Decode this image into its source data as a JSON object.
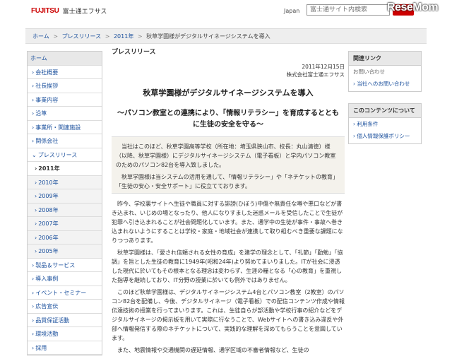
{
  "header": {
    "brand": "FUJITSU",
    "company": "富士通エフサス",
    "country": "Japan",
    "search_placeholder": "富士通サイト内検索",
    "watermark": "ReseMom"
  },
  "breadcrumb": {
    "items": [
      "ホーム",
      "プレスリリース",
      "2011年"
    ],
    "current": "秋草学園様がデジタルサイネージシステムを導入",
    "separator": ">"
  },
  "leftnav": {
    "items": [
      {
        "label": "ホーム"
      },
      {
        "label": "会社概要"
      },
      {
        "label": "社長挨拶"
      },
      {
        "label": "事業内容"
      },
      {
        "label": "沿革"
      },
      {
        "label": "事業所・関連施設"
      },
      {
        "label": "関係会社"
      },
      {
        "label": "プレスリリース"
      },
      {
        "label": "2011年"
      },
      {
        "label": "2010年"
      },
      {
        "label": "2009年"
      },
      {
        "label": "2008年"
      },
      {
        "label": "2007年"
      },
      {
        "label": "2006年"
      },
      {
        "label": "2005年"
      },
      {
        "label": "製品＆サービス"
      },
      {
        "label": "導入事例"
      },
      {
        "label": "イベント・セミナー"
      },
      {
        "label": "広告宣伝"
      },
      {
        "label": "品質保証活動"
      },
      {
        "label": "環境活動"
      },
      {
        "label": "採用"
      }
    ]
  },
  "main": {
    "section_label": "プレスリリース",
    "date": "2011年12月15日",
    "org": "株式会社富士通エフサス",
    "title": "秋草学園様がデジタルサイネージシステムを導入",
    "subtitle": "～パソコン教室との連携により、「情報リテラシー」を育成するとともに生徒の安全を守る～",
    "intro_1": "当社はこのほど、秋草学園高等学校（所在地：埼玉県狭山市、校長：丸山清徳）様（以降、秋草学園様）にデジタルサイネージシステム（電子看板）と学内パソコン教室のためのパソコン82台を導入致しました。",
    "intro_2": "秋草学園様は当システムの活用を通して、「情報リテラシー」や「ネチケットの教育」「生徒の安心・安全サポート」に役立てております。",
    "p1": "昨今、学校裏サイトへ生徒や職員に対する誹謗(ひぼう)中傷や無責任な噂や悪口などが書き込まれ、いじめの場となったり、他人になりすました迷惑メールを受信したことで生徒が犯罪へ引き込まれることが社会問題化しています。また、通学中の生徒が事件・事故へ巻き込まれないようにすることは学校・家庭・地域社会が連携して取り組むべき重要な課題になりつつあります。",
    "p2": "秋草学園様は、「愛され信頼される女性の育成」を建学の理念として、「礼節」「勤勉」「協調」を旨とした生徒の教育に1949年(昭和24年)より努めてまいりました。ITが社会に浸透した現代に於いてもその根本となる理念は変わらず、生涯の糧となる「心の教育」を重視した指導を継続しており、IT分野の授業に於いても例外ではありません。",
    "p3": "このほど秋草学園様は、デジタルサイネージシステム4台とパソコン教室（2教室）のパソコン82台を配備し、今後、デジタルサイネージ（電子看板）での配信コンテンツ作成や情報伝達技術の授業を行ってまいります。これは、生徒自らが部活動や学校行事の紹介などをデジタルサイネージの掲示板を用いて実際に行なうことで、Webサイトへの書き込み違反や外部へ情報発信する際のネチケットについて、実践的な理解を深めてもらうことを意図しています。",
    "p4": "また、地震情報や交通機関の遅延情報、通学区域の不審者情報など、生徒の"
  },
  "sidebar": {
    "related_title": "関連リンク",
    "related_note": "お問い合わせ",
    "related_link": "当社へのお問い合わせ",
    "about_title": "このコンテンツについて",
    "about_links": [
      "利用条件",
      "個人情報保護ポリシー"
    ]
  },
  "colors": {
    "brand_red": "#cc0000",
    "link_blue": "#1a4f9c",
    "box_beige": "#f4f2ec"
  }
}
